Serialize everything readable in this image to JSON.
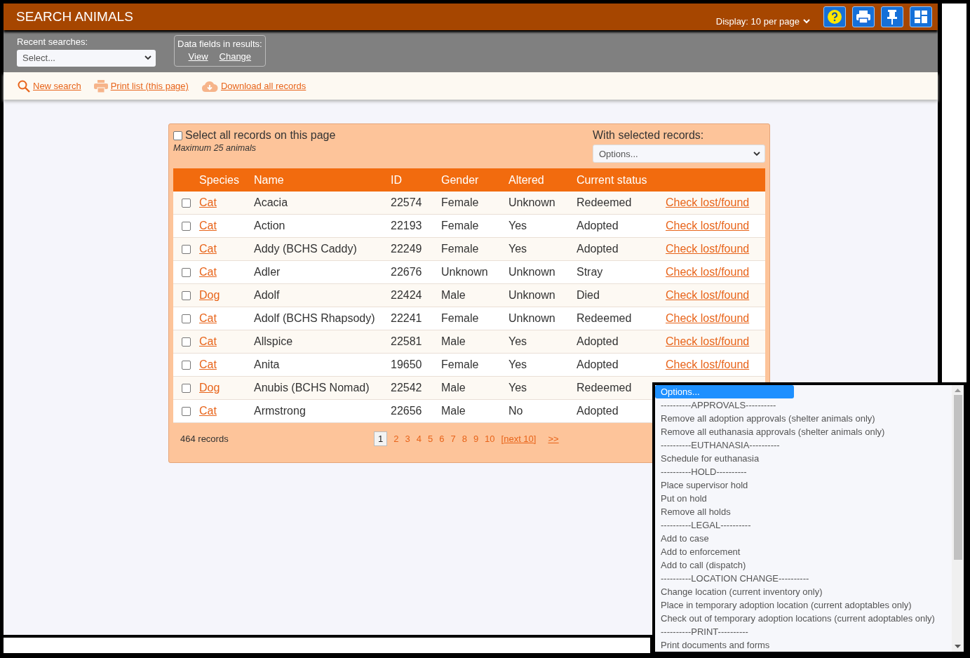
{
  "header": {
    "title": "SEARCH ANIMALS",
    "display": "Display: 10 per page"
  },
  "filters": {
    "recent_label": "Recent searches:",
    "recent_placeholder": "Select...",
    "fields_label": "Data fields in results:",
    "fields_links": [
      "View",
      "Change"
    ]
  },
  "toolbar": [
    {
      "kind": "search",
      "label": "New search"
    },
    {
      "kind": "print",
      "label": "Print list (this page)"
    },
    {
      "kind": "download",
      "label": "Download all records"
    }
  ],
  "card": {
    "select_all": {
      "label": "Select all records on this page",
      "checked": false
    },
    "note": "Maximum 25 animals",
    "with_selected_label": "With selected records:",
    "options_placeholder": "Options..."
  },
  "table": {
    "columns": [
      "Species",
      "Name",
      "ID",
      "Gender",
      "Altered",
      "Current status"
    ],
    "rows": [
      {
        "checked": false,
        "species": "Cat",
        "name": "Acacia",
        "id": "22574",
        "gender": "Female",
        "altered": "Unknown",
        "status": "Redeemed",
        "link": "Check lost/found"
      },
      {
        "checked": false,
        "species": "Cat",
        "name": "Action",
        "id": "22193",
        "gender": "Female",
        "altered": "Yes",
        "status": "Adopted",
        "link": "Check lost/found"
      },
      {
        "checked": false,
        "species": "Cat",
        "name": "Addy (BCHS Caddy)",
        "id": "22249",
        "gender": "Female",
        "altered": "Yes",
        "status": "Adopted",
        "link": "Check lost/found"
      },
      {
        "checked": false,
        "species": "Cat",
        "name": "Adler",
        "id": "22676",
        "gender": "Unknown",
        "altered": "Unknown",
        "status": "Stray",
        "link": "Check lost/found"
      },
      {
        "checked": false,
        "species": "Dog",
        "name": "Adolf",
        "id": "22424",
        "gender": "Male",
        "altered": "Unknown",
        "status": "Died",
        "link": "Check lost/found"
      },
      {
        "checked": false,
        "species": "Cat",
        "name": "Adolf (BCHS Rhapsody)",
        "id": "22241",
        "gender": "Female",
        "altered": "Unknown",
        "status": "Redeemed",
        "link": "Check lost/found"
      },
      {
        "checked": false,
        "species": "Cat",
        "name": "Allspice",
        "id": "22581",
        "gender": "Male",
        "altered": "Yes",
        "status": "Adopted",
        "link": "Check lost/found"
      },
      {
        "checked": false,
        "species": "Cat",
        "name": "Anita",
        "id": "19650",
        "gender": "Female",
        "altered": "Yes",
        "status": "Adopted",
        "link": "Check lost/found"
      },
      {
        "checked": false,
        "species": "Dog",
        "name": "Anubis (BCHS Nomad)",
        "id": "22542",
        "gender": "Male",
        "altered": "Yes",
        "status": "Redeemed"
      },
      {
        "checked": false,
        "species": "Cat",
        "name": "Armstrong",
        "id": "22656",
        "gender": "Male",
        "altered": "No",
        "status": "Adopted"
      }
    ]
  },
  "footer": {
    "count": "464 records",
    "pages": [
      {
        "label": "1",
        "selected": true
      },
      {
        "label": "2",
        "selected": false
      },
      {
        "label": "3",
        "selected": false
      },
      {
        "label": "4",
        "selected": false
      },
      {
        "label": "5",
        "selected": false
      },
      {
        "label": "6",
        "selected": false
      },
      {
        "label": "7",
        "selected": false
      },
      {
        "label": "8",
        "selected": false
      },
      {
        "label": "9",
        "selected": false
      },
      {
        "label": "10",
        "selected": false
      }
    ],
    "next": "[next 10]",
    "last": ">>"
  },
  "options_list": [
    {
      "label": "Options...",
      "selected": true
    },
    {
      "label": "----------APPROVALS----------",
      "selected": false
    },
    {
      "label": "Remove all adoption approvals (shelter animals only)",
      "selected": false
    },
    {
      "label": "Remove all euthanasia approvals (shelter animals only)",
      "selected": false
    },
    {
      "label": "----------EUTHANASIA----------",
      "selected": false
    },
    {
      "label": "Schedule for euthanasia",
      "selected": false
    },
    {
      "label": "----------HOLD----------",
      "selected": false
    },
    {
      "label": "Place supervisor hold",
      "selected": false
    },
    {
      "label": "Put on hold",
      "selected": false
    },
    {
      "label": "Remove all holds",
      "selected": false
    },
    {
      "label": "----------LEGAL----------",
      "selected": false
    },
    {
      "label": "Add to case",
      "selected": false
    },
    {
      "label": "Add to enforcement",
      "selected": false
    },
    {
      "label": "Add to call (dispatch)",
      "selected": false
    },
    {
      "label": "----------LOCATION CHANGE----------",
      "selected": false
    },
    {
      "label": "Change location (current inventory only)",
      "selected": false
    },
    {
      "label": "Place in temporary adoption location (current adoptables only)",
      "selected": false
    },
    {
      "label": "Check out of temporary adoption locations (current adoptables only)",
      "selected": false
    },
    {
      "label": "----------PRINT----------",
      "selected": false
    },
    {
      "label": "Print documents and forms",
      "selected": false
    }
  ]
}
